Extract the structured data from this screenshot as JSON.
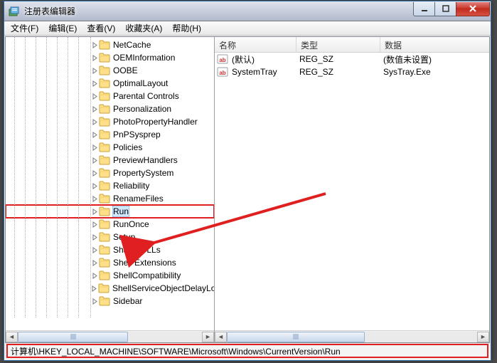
{
  "window": {
    "title": "注册表编辑器"
  },
  "menu": {
    "file": "文件(F)",
    "edit": "编辑(E)",
    "view": "查看(V)",
    "favorites": "收藏夹(A)",
    "help": "帮助(H)"
  },
  "tree": {
    "items": [
      {
        "label": "NetCache"
      },
      {
        "label": "OEMInformation"
      },
      {
        "label": "OOBE"
      },
      {
        "label": "OptimalLayout"
      },
      {
        "label": "Parental Controls"
      },
      {
        "label": "Personalization"
      },
      {
        "label": "PhotoPropertyHandler"
      },
      {
        "label": "PnPSysprep"
      },
      {
        "label": "Policies"
      },
      {
        "label": "PreviewHandlers"
      },
      {
        "label": "PropertySystem"
      },
      {
        "label": "Reliability"
      },
      {
        "label": "RenameFiles"
      },
      {
        "label": "Run"
      },
      {
        "label": "RunOnce"
      },
      {
        "label": "Setup"
      },
      {
        "label": "SharedDLLs"
      },
      {
        "label": "Shell Extensions"
      },
      {
        "label": "ShellCompatibility"
      },
      {
        "label": "ShellServiceObjectDelayLoad"
      },
      {
        "label": "Sidebar"
      }
    ],
    "selected_index": 13
  },
  "list": {
    "columns": {
      "name": "名称",
      "type": "类型",
      "data": "数据"
    },
    "rows": [
      {
        "name": "(默认)",
        "type": "REG_SZ",
        "data": "(数值未设置)"
      },
      {
        "name": "SystemTray",
        "type": "REG_SZ",
        "data": "SysTray.Exe"
      }
    ]
  },
  "statusbar": {
    "path": "计算机\\HKEY_LOCAL_MACHINE\\SOFTWARE\\Microsoft\\Windows\\CurrentVersion\\Run"
  },
  "col_widths": {
    "name": 115,
    "type": 118,
    "data": 150
  }
}
